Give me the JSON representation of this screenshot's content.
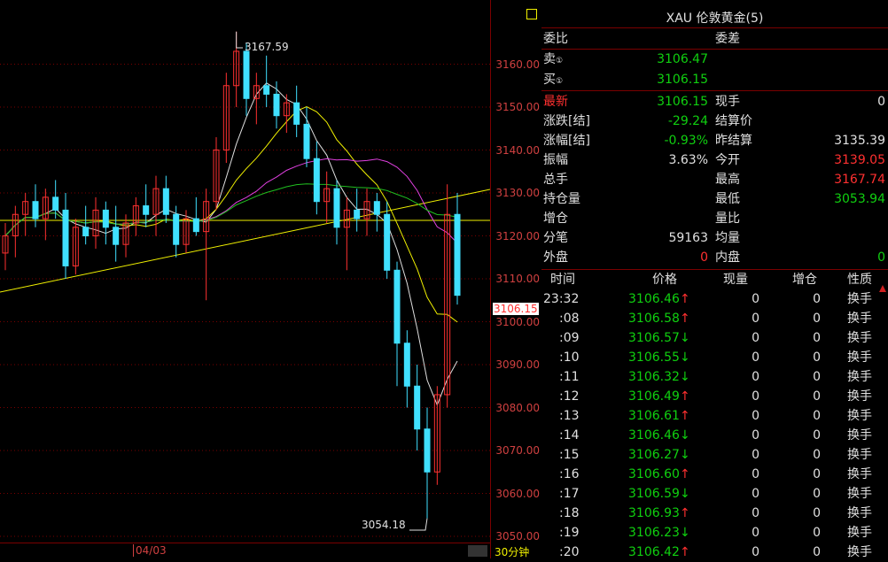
{
  "chart": {
    "high_label": "3167.59",
    "low_label": "3054.18",
    "date_label": "04/03",
    "period_label": "30分钟",
    "current_price_tag": "3106.15",
    "axis_labels": [
      "3160.00",
      "3150.00",
      "3140.00",
      "3130.00",
      "3120.00",
      "3110.00",
      "3100.00",
      "3090.00",
      "3080.00",
      "3070.00",
      "3060.00",
      "3050.00"
    ]
  },
  "quote": {
    "title": "XAU 伦敦黄金(5)",
    "weibi_label": "委比",
    "weicha_label": "委差",
    "sell_label": "卖",
    "sell_value": "3106.47",
    "buy_label": "买",
    "buy_value": "3106.15",
    "fields": [
      {
        "l1": "最新",
        "v1": "3106.15",
        "c1": "green",
        "l2": "现手",
        "v2": "0",
        "c2": "white",
        "l1c": "red"
      },
      {
        "l1": "涨跌[结]",
        "v1": "-29.24",
        "c1": "green",
        "l2": "结算价",
        "v2": "",
        "c2": "white"
      },
      {
        "l1": "涨幅[结]",
        "v1": "-0.93%",
        "c1": "green",
        "l2": "昨结算",
        "v2": "3135.39",
        "c2": "white"
      },
      {
        "l1": "振幅",
        "v1": "3.63%",
        "c1": "white",
        "l2": "今开",
        "v2": "3139.05",
        "c2": "red"
      },
      {
        "l1": "总手",
        "v1": "",
        "c1": "white",
        "l2": "最高",
        "v2": "3167.74",
        "c2": "red"
      },
      {
        "l1": "持仓量",
        "v1": "",
        "c1": "white",
        "l2": "最低",
        "v2": "3053.94",
        "c2": "green"
      },
      {
        "l1": "增仓",
        "v1": "",
        "c1": "white",
        "l2": "量比",
        "v2": "",
        "c2": "white"
      },
      {
        "l1": "分笔",
        "v1": "59163",
        "c1": "white",
        "l2": "均量",
        "v2": "",
        "c2": "white"
      },
      {
        "l1": "外盘",
        "v1": "0",
        "c1": "red",
        "l2": "内盘",
        "v2": "0",
        "c2": "green"
      }
    ]
  },
  "ticks": {
    "headers": [
      "时间",
      "价格",
      "现量",
      "增仓",
      "性质"
    ],
    "rows": [
      {
        "time": "23:32",
        "price": "3106.46",
        "dir": "↑",
        "qty": "0",
        "inc": "0",
        "type": "换手"
      },
      {
        "time": ":08",
        "price": "3106.58",
        "dir": "↑",
        "qty": "0",
        "inc": "0",
        "type": "换手"
      },
      {
        "time": ":09",
        "price": "3106.57",
        "dir": "↓",
        "qty": "0",
        "inc": "0",
        "type": "换手"
      },
      {
        "time": ":10",
        "price": "3106.55",
        "dir": "↓",
        "qty": "0",
        "inc": "0",
        "type": "换手"
      },
      {
        "time": ":11",
        "price": "3106.32",
        "dir": "↓",
        "qty": "0",
        "inc": "0",
        "type": "换手"
      },
      {
        "time": ":12",
        "price": "3106.49",
        "dir": "↑",
        "qty": "0",
        "inc": "0",
        "type": "换手"
      },
      {
        "time": ":13",
        "price": "3106.61",
        "dir": "↑",
        "qty": "0",
        "inc": "0",
        "type": "换手"
      },
      {
        "time": ":14",
        "price": "3106.46",
        "dir": "↓",
        "qty": "0",
        "inc": "0",
        "type": "换手"
      },
      {
        "time": ":15",
        "price": "3106.27",
        "dir": "↓",
        "qty": "0",
        "inc": "0",
        "type": "换手"
      },
      {
        "time": ":16",
        "price": "3106.60",
        "dir": "↑",
        "qty": "0",
        "inc": "0",
        "type": "换手"
      },
      {
        "time": ":17",
        "price": "3106.59",
        "dir": "↓",
        "qty": "0",
        "inc": "0",
        "type": "换手"
      },
      {
        "time": ":18",
        "price": "3106.93",
        "dir": "↑",
        "qty": "0",
        "inc": "0",
        "type": "换手"
      },
      {
        "time": ":19",
        "price": "3106.23",
        "dir": "↓",
        "qty": "0",
        "inc": "0",
        "type": "换手"
      },
      {
        "time": ":20",
        "price": "3106.42",
        "dir": "↑",
        "qty": "0",
        "inc": "0",
        "type": "换手"
      }
    ]
  },
  "colors": {
    "up": "#ff3030",
    "down": "#40e0ff",
    "grid": "#7a0000",
    "ma5": "#e0e0e0",
    "ma10": "#f0f000",
    "ma20": "#e040e0",
    "ma40": "#20c020"
  },
  "candles": [
    {
      "o": 3116,
      "h": 3123,
      "l": 3112,
      "c": 3120
    },
    {
      "o": 3120,
      "h": 3127,
      "l": 3115,
      "c": 3125
    },
    {
      "o": 3125,
      "h": 3130,
      "l": 3120,
      "c": 3128
    },
    {
      "o": 3128,
      "h": 3132,
      "l": 3122,
      "c": 3124
    },
    {
      "o": 3124,
      "h": 3131,
      "l": 3119,
      "c": 3129
    },
    {
      "o": 3129,
      "h": 3133,
      "l": 3124,
      "c": 3126
    },
    {
      "o": 3126,
      "h": 3130,
      "l": 3110,
      "c": 3113
    },
    {
      "o": 3113,
      "h": 3124,
      "l": 3111,
      "c": 3122
    },
    {
      "o": 3122,
      "h": 3127,
      "l": 3118,
      "c": 3120
    },
    {
      "o": 3120,
      "h": 3129,
      "l": 3117,
      "c": 3126
    },
    {
      "o": 3126,
      "h": 3128,
      "l": 3118,
      "c": 3122
    },
    {
      "o": 3122,
      "h": 3127,
      "l": 3114,
      "c": 3118
    },
    {
      "o": 3118,
      "h": 3125,
      "l": 3115,
      "c": 3123
    },
    {
      "o": 3123,
      "h": 3129,
      "l": 3120,
      "c": 3127
    },
    {
      "o": 3127,
      "h": 3132,
      "l": 3122,
      "c": 3125
    },
    {
      "o": 3125,
      "h": 3134,
      "l": 3120,
      "c": 3131
    },
    {
      "o": 3131,
      "h": 3134,
      "l": 3123,
      "c": 3125
    },
    {
      "o": 3125,
      "h": 3127,
      "l": 3115,
      "c": 3118
    },
    {
      "o": 3118,
      "h": 3126,
      "l": 3116,
      "c": 3124
    },
    {
      "o": 3124,
      "h": 3129,
      "l": 3120,
      "c": 3121
    },
    {
      "o": 3121,
      "h": 3131,
      "l": 3105,
      "c": 3128
    },
    {
      "o": 3128,
      "h": 3143,
      "l": 3126,
      "c": 3140
    },
    {
      "o": 3140,
      "h": 3158,
      "l": 3137,
      "c": 3155
    },
    {
      "o": 3155,
      "h": 3167.59,
      "l": 3150,
      "c": 3163
    },
    {
      "o": 3163,
      "h": 3165,
      "l": 3148,
      "c": 3152
    },
    {
      "o": 3152,
      "h": 3158,
      "l": 3146,
      "c": 3155
    },
    {
      "o": 3155,
      "h": 3162,
      "l": 3150,
      "c": 3153
    },
    {
      "o": 3153,
      "h": 3156,
      "l": 3145,
      "c": 3148
    },
    {
      "o": 3148,
      "h": 3153,
      "l": 3144,
      "c": 3151
    },
    {
      "o": 3151,
      "h": 3155,
      "l": 3143,
      "c": 3146
    },
    {
      "o": 3146,
      "h": 3150,
      "l": 3136,
      "c": 3138
    },
    {
      "o": 3138,
      "h": 3142,
      "l": 3125,
      "c": 3128
    },
    {
      "o": 3128,
      "h": 3135,
      "l": 3123,
      "c": 3131
    },
    {
      "o": 3131,
      "h": 3133,
      "l": 3118,
      "c": 3122
    },
    {
      "o": 3122,
      "h": 3129,
      "l": 3112,
      "c": 3126
    },
    {
      "o": 3126,
      "h": 3131,
      "l": 3121,
      "c": 3124
    },
    {
      "o": 3124,
      "h": 3131,
      "l": 3120,
      "c": 3128
    },
    {
      "o": 3128,
      "h": 3130,
      "l": 3121,
      "c": 3125
    },
    {
      "o": 3125,
      "h": 3128,
      "l": 3110,
      "c": 3112
    },
    {
      "o": 3112,
      "h": 3114,
      "l": 3085,
      "c": 3095
    },
    {
      "o": 3095,
      "h": 3098,
      "l": 3080,
      "c": 3085
    },
    {
      "o": 3085,
      "h": 3090,
      "l": 3070,
      "c": 3075
    },
    {
      "o": 3075,
      "h": 3080,
      "l": 3054.18,
      "c": 3065
    },
    {
      "o": 3065,
      "h": 3085,
      "l": 3062,
      "c": 3083
    },
    {
      "o": 3083,
      "h": 3132,
      "l": 3080,
      "c": 3125
    },
    {
      "o": 3125,
      "h": 3130,
      "l": 3104,
      "c": 3106.15
    }
  ]
}
